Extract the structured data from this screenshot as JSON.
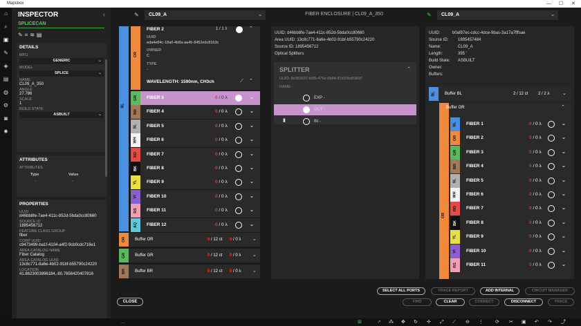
{
  "window": {
    "title": "Mapsbox"
  },
  "inspector": {
    "title": "INSPECTOR",
    "subtitle": "SPLICECAN",
    "details": {
      "header": "DETAILS",
      "mfg_label": "MFG",
      "mfg_value": "GENERIC",
      "model_label": "MODEL",
      "model_value": "SPLICE",
      "name_label": "NAME",
      "name_value": "CL09_A_350",
      "angle_label": "ANGLE",
      "angle_value": "27.786",
      "scale_label": "SCALE",
      "scale_value": "1",
      "build_label": "BUILD STATE",
      "build_value": "ASBUILT"
    },
    "attributes": {
      "header": "ATTRIBUTES",
      "sub": "ATTRIBUTES",
      "col_type": "Type",
      "col_value": "Value",
      "dash1": "-",
      "dash2": "-"
    },
    "properties": {
      "header": "PROPERTIES",
      "items": [
        {
          "label": "UUID",
          "value": "d46bb8fe-7ae4-411c-852d-5bda0cc80660"
        },
        {
          "label": "SOURCE ID",
          "value": "1895456712"
        },
        {
          "label": "FEATURE CLASS GROUP",
          "value": "fiber"
        },
        {
          "label": "CORP UUID",
          "value": "c9473499-ba1f-4104-a4f2-9cb0cdc716e1"
        },
        {
          "label": "AREA CATALOG NAME",
          "value": "Fiber Catalog"
        },
        {
          "label": "AREA CATALOG UUID",
          "value": "13c8c771-8a6e-4b02-91bf-b55790c24220"
        },
        {
          "label": "LOCATION",
          "value": "41.8623003896184,-80.7656420407816"
        }
      ]
    },
    "close_label": "CLOSE"
  },
  "left_panel": {
    "header": "CL09_A",
    "top_fiber": {
      "name": "FIBER 2",
      "count": "1 / 1 λ",
      "uuid_label": "UUID",
      "uuid_value": "eda4e84c-18a0-4b8a-aa45-8452e6c8163c",
      "owner_label": "OWNER",
      "owner_value": "C",
      "type_label": "TYPE",
      "type_value": "-",
      "wavelength": "WAVELENGTH:  1590nm, CH3ch",
      "code": "OR"
    },
    "outer_code": "BL",
    "fibers": [
      {
        "code": "GR",
        "name": "FIBER 3",
        "used": "0",
        "total": "/ 0 λ",
        "color": "#5cb85c",
        "selected": true
      },
      {
        "code": "BR",
        "name": "FIBER 4",
        "used": "0",
        "total": "/ 0 λ",
        "color": "#a0785a"
      },
      {
        "code": "SL",
        "name": "FIBER 5",
        "used": "0",
        "total": "/ 0 λ",
        "color": "#b0b0b0"
      },
      {
        "code": "WH",
        "name": "FIBER 6",
        "used": "0",
        "total": "/ 0 λ",
        "color": "#f2f2f2"
      },
      {
        "code": "RD",
        "name": "FIBER 7",
        "used": "0",
        "total": "/ 0 λ",
        "color": "#e34b4b"
      },
      {
        "code": "BK",
        "name": "FIBER 8",
        "used": "0",
        "total": "/ 0 λ",
        "color": "#111111",
        "dark": true
      },
      {
        "code": "YL",
        "name": "FIBER 9",
        "used": "0",
        "total": "/ 0 λ",
        "color": "#e8e040"
      },
      {
        "code": "VI",
        "name": "FIBER 10",
        "used": "0",
        "total": "/ 0 λ",
        "color": "#8a5fd0"
      },
      {
        "code": "RS",
        "name": "FIBER 11",
        "used": "0",
        "total": "/ 0 λ",
        "color": "#f0a0b0"
      },
      {
        "code": "AQ",
        "name": "FIBER 12",
        "used": "0",
        "total": "/ 0 λ",
        "color": "#60c8d8"
      }
    ],
    "buffers": [
      {
        "code": "OR",
        "name": "Buffer OR",
        "used": "0",
        "cnt": "/ 12 ct",
        "used2": "0",
        "lam": "/ 0 λ",
        "color": "#f0883e"
      },
      {
        "code": "GR",
        "name": "Buffer GR",
        "used": "0",
        "cnt": "/ 12 ct",
        "used2": "0",
        "lam": "/ 0 λ",
        "color": "#5cb85c"
      },
      {
        "code": "BR",
        "name": "Buffer BR",
        "used": "0",
        "cnt": "/ 12 ct",
        "used2": "0",
        "lam": "/ 0 λ",
        "color": "#a0785a"
      }
    ]
  },
  "center_panel": {
    "title": "FIBER ENCLOSURE | CL09_A_350",
    "uuid": "UUID: d46bb8fe-7ae4-411c-852d-5bda0cc80660",
    "area_uuid": "Area UUID: 13c8c771-8a6e-4b02-91bf-b55790c24220",
    "source_id": "Source ID: 1895456712",
    "optical": "Optical Splitters:",
    "splitter": {
      "title": "SPLITTER",
      "uuid": "UUID: 8e952037-b6f5-476e-8b84-81b35bd03697",
      "name": "NAME: -",
      "ports": [
        {
          "label": "EXP -"
        },
        {
          "label": "OUT -",
          "selected": true
        },
        {
          "label": "IN -"
        }
      ]
    }
  },
  "right_panel": {
    "header": "CL09_A",
    "uuid_label": "UUID:",
    "uuid_value": "b0af87ec-cdcc-4dce-9bas-3a17a7fffsae",
    "source_label": "Source ID:",
    "source_value": "1895457484",
    "name_label": "Name:",
    "name_value": "CL09_A",
    "length_label": "Length:",
    "length_value": "395 '",
    "build_label": "Build State:",
    "build_value": "ASBUILT",
    "owner_label": "Owner:",
    "owner_value": "",
    "buffers_label": "Buffers:",
    "buffer_bl": {
      "code": "BL",
      "name": "Buffer BL",
      "cnt": "2 / 12 ct",
      "lam": "2 / 2 λ"
    },
    "buffer_or": {
      "code": "OR",
      "name": "Buffer OR"
    },
    "fibers": [
      {
        "code": "BL",
        "name": "FIBER 1",
        "color": "#4a8fe0"
      },
      {
        "code": "OR",
        "name": "FIBER 2",
        "color": "#f0883e"
      },
      {
        "code": "GR",
        "name": "FIBER 3",
        "color": "#5cb85c"
      },
      {
        "code": "BR",
        "name": "FIBER 4",
        "color": "#a0785a"
      },
      {
        "code": "SL",
        "name": "FIBER 5",
        "color": "#b0b0b0"
      },
      {
        "code": "WH",
        "name": "FIBER 6",
        "color": "#f2f2f2"
      },
      {
        "code": "RD",
        "name": "FIBER 7",
        "color": "#e34b4b"
      },
      {
        "code": "BK",
        "name": "FIBER 8",
        "color": "#111111",
        "dark": true
      },
      {
        "code": "YL",
        "name": "FIBER 9",
        "color": "#e8e040"
      },
      {
        "code": "VI",
        "name": "FIBER 10",
        "color": "#8a5fd0"
      },
      {
        "code": "RS",
        "name": "FIBER 11",
        "color": "#f0a0b0"
      }
    ],
    "fiber_used": "0",
    "fiber_total": "/ 0 λ"
  },
  "buttons": {
    "select_all": "SELECT ALL PORTS",
    "trace_report": "TRACE REPORT",
    "add_internal": "ADD INTERNAL",
    "circuit_manager": "CIRCUIT MANAGER",
    "find": "FIND",
    "clear": "CLEAR",
    "connect": "CONNECT",
    "disconnect": "DISCONNECT",
    "trace": "TRACE"
  },
  "status": {
    "text": "..."
  }
}
